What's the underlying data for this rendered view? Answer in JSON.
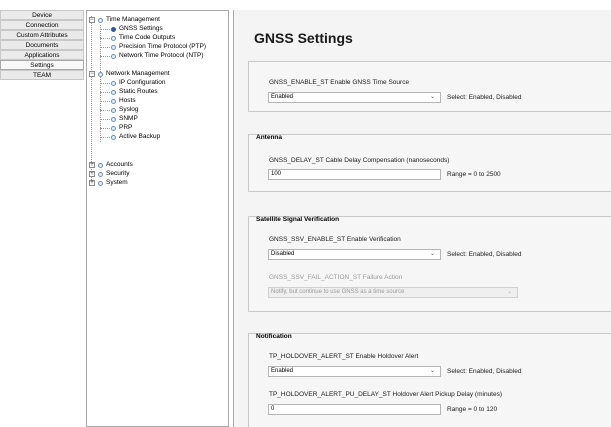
{
  "nav": {
    "items": [
      {
        "label": "Device"
      },
      {
        "label": "Connection"
      },
      {
        "label": "Custom Attributes"
      },
      {
        "label": "Documents"
      },
      {
        "label": "Applications"
      },
      {
        "label": "Settings",
        "active": true
      },
      {
        "label": "TEAM"
      }
    ]
  },
  "tree": {
    "time_management": "Time Management",
    "gnss_settings": "GNSS Settings",
    "time_code_outputs": "Time Code Outputs",
    "ptp": "Precision Time Protocol (PTP)",
    "ntp": "Network Time Protocol (NTP)",
    "network_management": "Network Management",
    "ip_configuration": "IP Configuration",
    "static_routes": "Static Routes",
    "hosts": "Hosts",
    "syslog": "Syslog",
    "snmp": "SNMP",
    "prp": "PRP",
    "active_backup": "Active Backup",
    "accounts": "Accounts",
    "security": "Security",
    "system": "System",
    "expander_collapsed": "+",
    "expander_expanded": "−"
  },
  "page": {
    "title": "GNSS Settings"
  },
  "general": {
    "enable_label": "GNSS_ENABLE_ST  Enable GNSS Time Source",
    "enable_value": "Enabled",
    "enable_hint": "Select: Enabled, Disabled"
  },
  "antenna": {
    "title": "Antenna",
    "delay_label": "GNSS_DELAY_ST  Cable Delay Compensation (nanoseconds)",
    "delay_value": "100",
    "delay_hint": "Range = 0 to 2500"
  },
  "ssv": {
    "title": "Satellite Signal Verification",
    "enable_label": "GNSS_SSV_ENABLE_ST  Enable Verification",
    "enable_value": "Disabled",
    "enable_hint": "Select: Enabled, Disabled",
    "fail_label": "GNSS_SSV_FAIL_ACTION_ST  Failure Action",
    "fail_value": "Notify, but continue to use GNSS as a time source"
  },
  "notification": {
    "title": "Notification",
    "holdover_label": "TP_HOLDOVER_ALERT_ST  Enable Holdover Alert",
    "holdover_value": "Enabled",
    "holdover_hint": "Select: Enabled, Disabled",
    "pickup_label": "TP_HOLDOVER_ALERT_PU_DELAY_ST  Holdover Alert Pickup Delay (minutes)",
    "pickup_value": "0",
    "pickup_hint": "Range = 0 to 120"
  },
  "icons": {
    "chevron": "⌄"
  }
}
